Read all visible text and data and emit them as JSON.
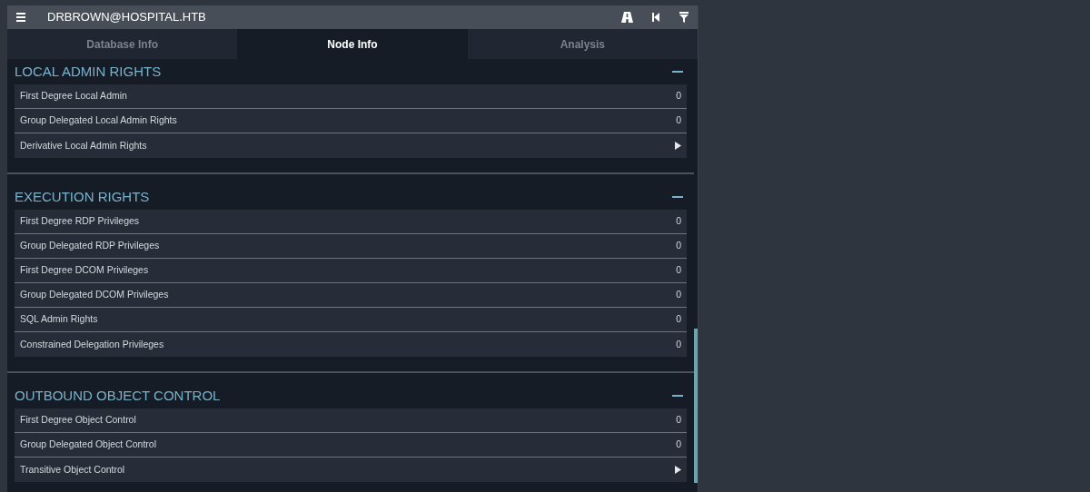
{
  "header": {
    "title": "DRBROWN@HOSPITAL.HTB"
  },
  "tabs": [
    {
      "label": "Database Info",
      "selected": false
    },
    {
      "label": "Node Info",
      "selected": true
    },
    {
      "label": "Analysis",
      "selected": false
    }
  ],
  "sections": [
    {
      "title": "LOCAL ADMIN RIGHTS",
      "expanded": true,
      "rows": [
        {
          "label": "First Degree Local Admin",
          "kind": "count",
          "value": "0"
        },
        {
          "label": "Group Delegated Local Admin Rights",
          "kind": "count",
          "value": "0"
        },
        {
          "label": "Derivative Local Admin Rights",
          "kind": "expand"
        }
      ]
    },
    {
      "title": "EXECUTION RIGHTS",
      "expanded": true,
      "rows": [
        {
          "label": "First Degree RDP Privileges",
          "kind": "count",
          "value": "0"
        },
        {
          "label": "Group Delegated RDP Privileges",
          "kind": "count",
          "value": "0"
        },
        {
          "label": "First Degree DCOM Privileges",
          "kind": "count",
          "value": "0"
        },
        {
          "label": "Group Delegated DCOM Privileges",
          "kind": "count",
          "value": "0"
        },
        {
          "label": "SQL Admin Rights",
          "kind": "count",
          "value": "0"
        },
        {
          "label": "Constrained Delegation Privileges",
          "kind": "count",
          "value": "0"
        }
      ]
    },
    {
      "title": "OUTBOUND OBJECT CONTROL",
      "expanded": true,
      "rows": [
        {
          "label": "First Degree Object Control",
          "kind": "count",
          "value": "0"
        },
        {
          "label": "Group Delegated Object Control",
          "kind": "count",
          "value": "0"
        },
        {
          "label": "Transitive Object Control",
          "kind": "expand"
        }
      ]
    }
  ]
}
